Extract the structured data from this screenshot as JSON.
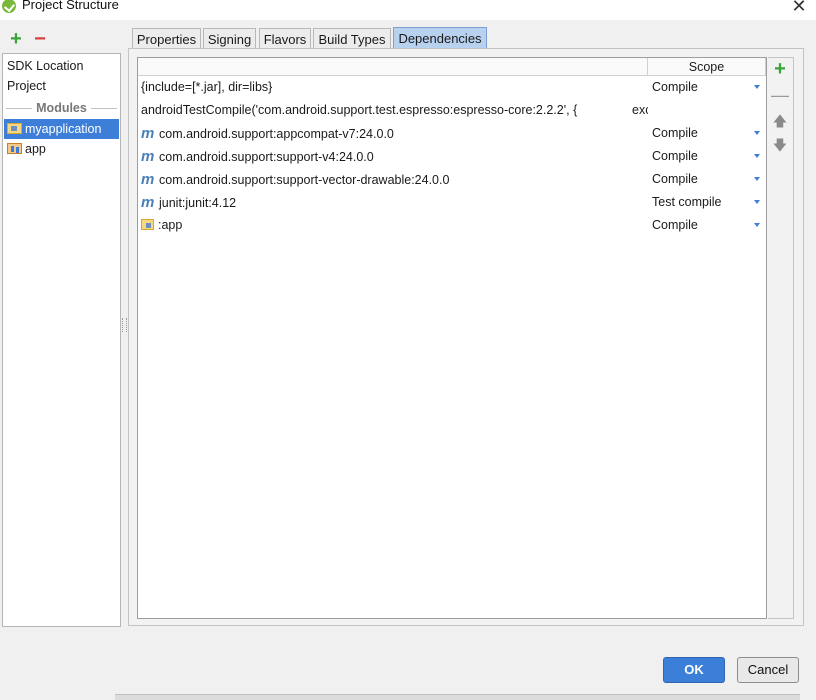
{
  "window": {
    "title": "Project Structure",
    "close_glyph": "✕"
  },
  "left_panel": {
    "add_glyph": "+",
    "remove_glyph": "−",
    "items": [
      {
        "label": "SDK Location"
      },
      {
        "label": "Project"
      }
    ],
    "modules_header": "Modules",
    "modules": [
      {
        "label": "myapplication",
        "icon": "module-folder-icon",
        "selected": true
      },
      {
        "label": "app",
        "icon": "android-app-module-icon",
        "selected": false
      }
    ]
  },
  "tabs": [
    {
      "label": "Properties"
    },
    {
      "label": "Signing"
    },
    {
      "label": "Flavors"
    },
    {
      "label": "Build Types"
    },
    {
      "label": "Dependencies",
      "active": true
    }
  ],
  "table": {
    "columns": {
      "name": "",
      "scope": "Scope"
    },
    "rows": [
      {
        "name": "{include=[*.jar], dir=libs}",
        "scope": "Compile",
        "icon": ""
      },
      {
        "name": "androidTestCompile('com.android.support.test.espresso:espresso-core:2.2.2', {",
        "scope": "",
        "overflow": "exclude",
        "icon": ""
      },
      {
        "name": "com.android.support:appcompat-v7:24.0.0",
        "scope": "Compile",
        "icon": "maven-icon",
        "icon_glyph": "m"
      },
      {
        "name": "com.android.support:support-v4:24.0.0",
        "scope": "Compile",
        "icon": "maven-icon",
        "icon_glyph": "m"
      },
      {
        "name": "com.android.support:support-vector-drawable:24.0.0",
        "scope": "Compile",
        "icon": "maven-icon",
        "icon_glyph": "m"
      },
      {
        "name": "junit:junit:4.12",
        "scope": "Test compile",
        "icon": "maven-icon",
        "icon_glyph": "m"
      },
      {
        "name": ":app",
        "scope": "Compile",
        "icon": "module-folder-icon"
      }
    ]
  },
  "right_tools": {
    "add": "+",
    "remove": "—",
    "up": "🡅",
    "down": "🡇"
  },
  "buttons": {
    "ok": "OK",
    "cancel": "Cancel"
  },
  "colors": {
    "accent": "#3c7fd8",
    "add": "#3aa33a",
    "remove": "#d93a3a"
  }
}
